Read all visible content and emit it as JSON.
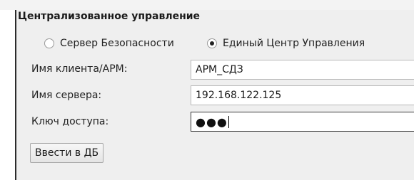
{
  "group": {
    "title": "Централизованное управление"
  },
  "mode": {
    "options": [
      {
        "label": "Сервер Безопасности",
        "checked": false
      },
      {
        "label": "Единый Центр Управления",
        "checked": true
      }
    ]
  },
  "form": {
    "client_label": "Имя клиента/АРМ:",
    "client_value": "АРМ_СДЗ",
    "server_label": "Имя сервера:",
    "server_value": "192.168.122.125",
    "key_label": "Ключ доступа:",
    "key_value": "●●●"
  },
  "actions": {
    "enter_db_label": "Ввести в ДБ"
  }
}
